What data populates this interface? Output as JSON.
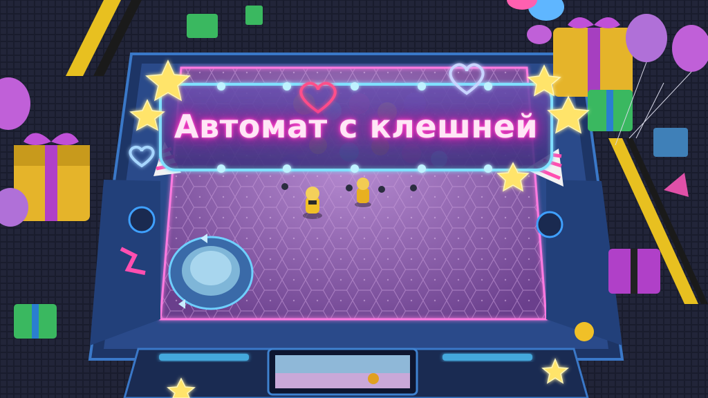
{
  "game": {
    "title": "Автомат с клешней"
  },
  "colors": {
    "neon_pink": "#ff4fd0",
    "neon_cyan": "#5fd6ff",
    "arena_floor": "#8a5fa8",
    "frame_blue": "#2c5aa8",
    "gift_yellow": "#e5b42a",
    "gift_purple": "#a63fc0",
    "star_yellow": "#ffe46a"
  },
  "icons": [
    "star-icon",
    "heart-icon",
    "party-hat-icon",
    "balloon-icon",
    "gift-box-icon",
    "skull-icon"
  ]
}
